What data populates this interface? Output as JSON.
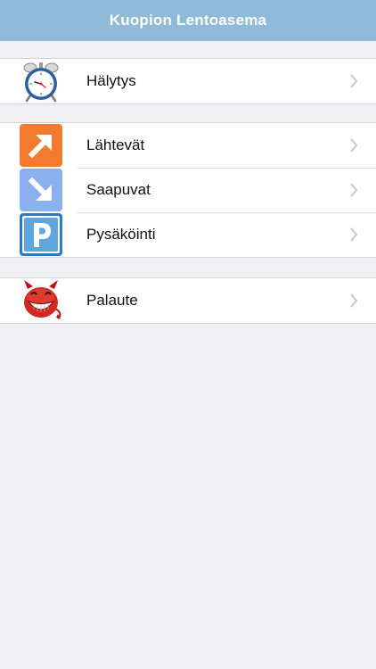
{
  "navbar": {
    "title": "Kuopion Lentoasema"
  },
  "groups": [
    {
      "items": [
        {
          "label": "Hälytys",
          "icon": "alarm-clock-icon"
        }
      ]
    },
    {
      "items": [
        {
          "label": "Lähtevät",
          "icon": "departures-arrow-icon"
        },
        {
          "label": "Saapuvat",
          "icon": "arrivals-arrow-icon"
        },
        {
          "label": "Pysäköinti",
          "icon": "parking-icon"
        }
      ]
    },
    {
      "items": [
        {
          "label": "Palaute",
          "icon": "devil-face-icon"
        }
      ]
    }
  ],
  "colors": {
    "navbar_bg": "#8fbbd9",
    "page_bg": "#efeff4",
    "departures_tile": "#f47a2f",
    "arrivals_tile": "#8bb0ef",
    "parking_tile": "#5fa6dc",
    "chevron": "#c7c7cc"
  }
}
